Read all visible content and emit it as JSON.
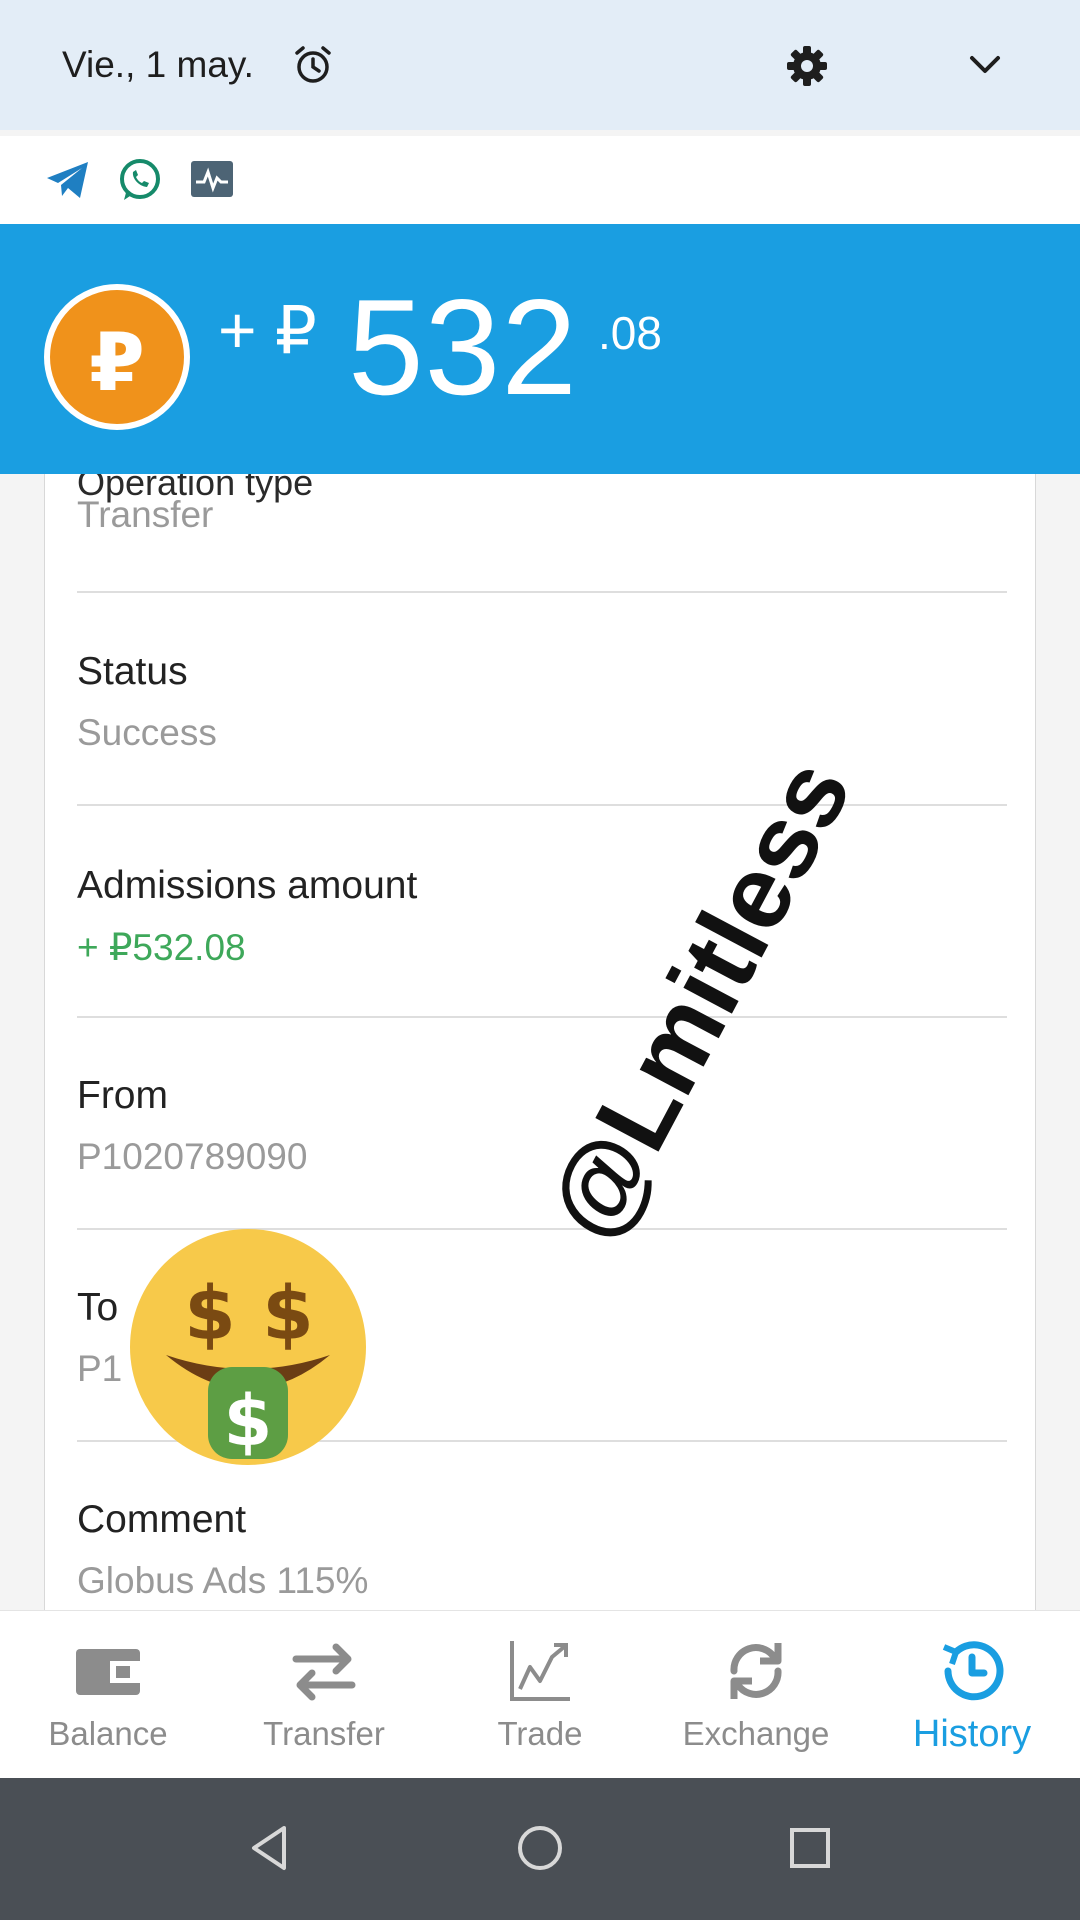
{
  "status_bar": {
    "date": "Vie., 1 may.",
    "icons": [
      "alarm-icon",
      "settings-gear-icon",
      "chevron-down-icon"
    ]
  },
  "notification_icons": [
    "telegram-icon",
    "whatsapp-icon",
    "activity-monitor-icon"
  ],
  "header": {
    "currency_symbol": "₽",
    "amount_prefix": "+ ₽",
    "amount_integer": "532",
    "amount_decimal": ".08",
    "accent_color": "#1a9ee1",
    "coin_color": "#f0921b"
  },
  "details": {
    "partial_label": "Operation type",
    "fields": [
      {
        "label": "",
        "value": "Transfer"
      },
      {
        "label": "Status",
        "value": "Success"
      },
      {
        "label": "Admissions amount",
        "value": "+ ₽532.08",
        "value_color": "#3ea85a"
      },
      {
        "label": "From",
        "value": "P1020789090"
      },
      {
        "label": "To",
        "value": "P1"
      },
      {
        "label": "Comment",
        "value": "Globus Ads 115%"
      }
    ]
  },
  "watermark": "@Lmitless",
  "overlay_emoji": "money-mouth-face-emoji",
  "bottom_nav": {
    "items": [
      {
        "label": "Balance",
        "icon": "wallet-icon",
        "active": false
      },
      {
        "label": "Transfer",
        "icon": "transfer-arrows-icon",
        "active": false
      },
      {
        "label": "Trade",
        "icon": "trade-chart-icon",
        "active": false
      },
      {
        "label": "Exchange",
        "icon": "exchange-refresh-icon",
        "active": false
      },
      {
        "label": "History",
        "icon": "history-clock-icon",
        "active": true
      }
    ]
  },
  "system_nav": [
    "back-icon",
    "home-icon",
    "recents-icon"
  ]
}
